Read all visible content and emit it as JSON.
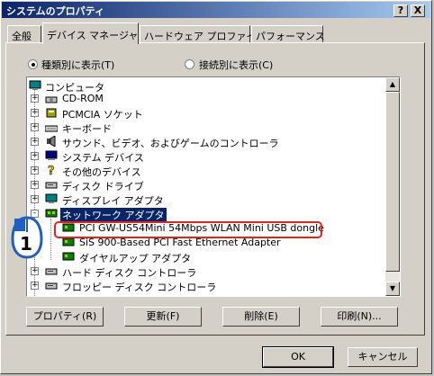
{
  "window": {
    "title": "システムのプロパティ",
    "help_button": "?",
    "close_button": "X"
  },
  "tabs": [
    {
      "label": "全般"
    },
    {
      "label": "デバイス マネージャ"
    },
    {
      "label": "ハードウェア プロファイル"
    },
    {
      "label": "パフォーマンス"
    }
  ],
  "view_options": {
    "by_type": "種類別に表示(T)",
    "by_connection": "接続別に表示(C)",
    "selected": "by_type"
  },
  "tree": {
    "root": "コンピュータ",
    "items": [
      {
        "label": "CD-ROM",
        "icon": "cdrom-icon",
        "expander": "+"
      },
      {
        "label": "PCMCIA ソケット",
        "icon": "pcmcia-icon",
        "expander": "+"
      },
      {
        "label": "キーボード",
        "icon": "keyboard-icon",
        "expander": "+"
      },
      {
        "label": "サウンド、ビデオ、およびゲームのコントローラ",
        "icon": "sound-icon",
        "expander": "+"
      },
      {
        "label": "システム デバイス",
        "icon": "system-device-icon",
        "expander": "+"
      },
      {
        "label": "その他のデバイス",
        "icon": "question-icon",
        "expander": "+"
      },
      {
        "label": "ディスク ドライブ",
        "icon": "disk-drive-icon",
        "expander": "+"
      },
      {
        "label": "ディスプレイ アダプタ",
        "icon": "display-icon",
        "expander": "+"
      },
      {
        "label": "ネットワーク アダプタ",
        "icon": "network-icon",
        "expander": "-"
      }
    ],
    "network_children": [
      "PCI GW-US54Mini 54Mbps WLAN Mini USB dongle",
      "SiS 900-Based PCI Fast Ethernet Adapter",
      "ダイヤルアップ アダプタ"
    ],
    "after_items": [
      {
        "label": "ハード ディスク コントローラ",
        "icon": "hdd-controller-icon",
        "expander": "+"
      },
      {
        "label": "フロッピー ディスク コントローラ",
        "icon": "floppy-icon",
        "expander": "+"
      }
    ]
  },
  "callout": {
    "number": "1"
  },
  "buttons": {
    "properties": "プロパティ(R)",
    "refresh": "更新(F)",
    "remove": "削除(E)",
    "print": "印刷(N)...",
    "ok": "OK",
    "cancel": "キャンセル"
  },
  "colors": {
    "title_bar": "#0a246a",
    "selection": "#0a246a",
    "highlight_ring": "#e2241f",
    "callout_blue": "#1f5fbf"
  }
}
